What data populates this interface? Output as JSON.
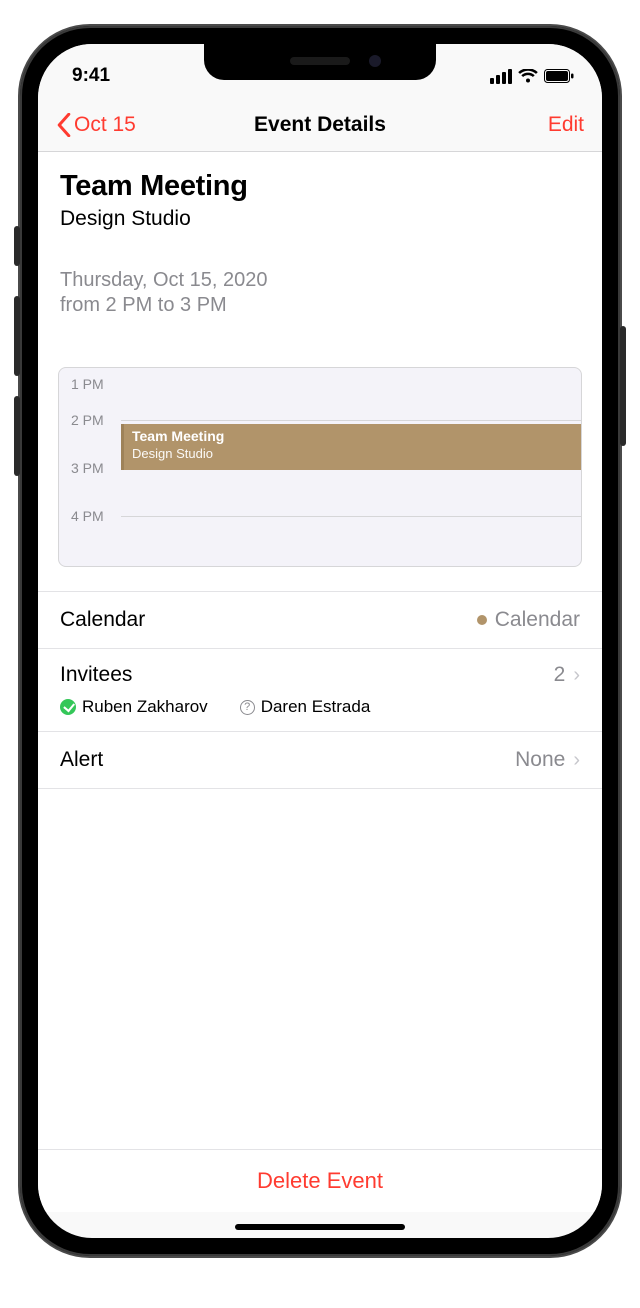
{
  "status": {
    "time": "9:41"
  },
  "nav": {
    "back_label": "Oct 15",
    "title": "Event Details",
    "edit_label": "Edit"
  },
  "event": {
    "title": "Team Meeting",
    "location": "Design Studio",
    "date_line": "Thursday, Oct 15, 2020",
    "time_line": "from 2 PM to 3 PM"
  },
  "timeline": {
    "hours": [
      "1 PM",
      "2 PM",
      "3 PM",
      "4 PM"
    ],
    "block_title": "Team Meeting",
    "block_sub": "Design Studio"
  },
  "rows": {
    "calendar_label": "Calendar",
    "calendar_value": "Calendar",
    "invitees_label": "Invitees",
    "invitees_count": "2",
    "alert_label": "Alert",
    "alert_value": "None"
  },
  "invitees": [
    {
      "name": "Ruben Zakharov",
      "status": "accepted"
    },
    {
      "name": "Daren Estrada",
      "status": "pending"
    }
  ],
  "delete_label": "Delete Event"
}
